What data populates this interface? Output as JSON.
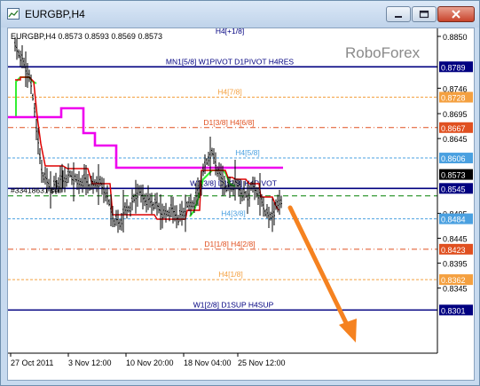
{
  "window": {
    "title": "EURGBP,H4"
  },
  "chart_header": "EURGBP,H4  0.8573 0.8593 0.8569 0.8573",
  "watermark": "RoboForex",
  "price_labels": [
    {
      "text": "0.8850",
      "kind": "scale",
      "color": "#000000"
    },
    {
      "text": "0.8789",
      "kind": "level",
      "color": "#000080"
    },
    {
      "text": "0.8746",
      "kind": "scale",
      "color": "#000000"
    },
    {
      "text": "0.8728",
      "kind": "level",
      "color": "#f4a040"
    },
    {
      "text": "0.8695",
      "kind": "scale",
      "color": "#000000"
    },
    {
      "text": "0.8667",
      "kind": "level",
      "color": "#e05020"
    },
    {
      "text": "0.8645",
      "kind": "scale",
      "color": "#000000"
    },
    {
      "text": "0.8606",
      "kind": "level",
      "color": "#4aa0e0"
    },
    {
      "text": "0.8573",
      "kind": "level",
      "color": "#000000"
    },
    {
      "text": "0.8545",
      "kind": "level",
      "color": "#000080"
    },
    {
      "text": "0.8495",
      "kind": "scale",
      "color": "#000000"
    },
    {
      "text": "0.8484",
      "kind": "level",
      "color": "#4aa0e0"
    },
    {
      "text": "0.8445",
      "kind": "scale",
      "color": "#000000"
    },
    {
      "text": "0.8423",
      "kind": "level",
      "color": "#e05020"
    },
    {
      "text": "0.8395",
      "kind": "scale",
      "color": "#000000"
    },
    {
      "text": "0.8362",
      "kind": "level",
      "color": "#f4a040"
    },
    {
      "text": "0.8345",
      "kind": "scale",
      "color": "#000000"
    },
    {
      "text": "0.8301",
      "kind": "level",
      "color": "#000080"
    }
  ],
  "level_lines": [
    {
      "label": "H4[+1/8]",
      "price": 0.885,
      "color": "#000080",
      "style": "none"
    },
    {
      "label": "MN1[5/8] W1PIVOT D1PIVOT H4RES",
      "price": 0.8789,
      "color": "#000080",
      "style": "solid"
    },
    {
      "label": "H4[7/8]",
      "price": 0.8728,
      "color": "#f4a040",
      "style": "dash"
    },
    {
      "label": "D1[3/8] H4[6/8]",
      "price": 0.8667,
      "color": "#e05020",
      "style": "dashdot"
    },
    {
      "label": "H4[5/8]",
      "price": 0.8606,
      "color": "#4aa0e0",
      "style": "dash"
    },
    {
      "label": "W1[3/8] D1[2/8] H4PIVOT",
      "price": 0.8545,
      "color": "#000080",
      "style": "solid"
    },
    {
      "label": "H4[3/8]",
      "price": 0.8484,
      "color": "#4aa0e0",
      "style": "dash"
    },
    {
      "label": "D1[1/8] H4[2/8]",
      "price": 0.8423,
      "color": "#e05020",
      "style": "dashdot"
    },
    {
      "label": "H4[1/8]",
      "price": 0.8362,
      "color": "#f4a040",
      "style": "dash"
    },
    {
      "label": "W1[2/8] D1SUP H4SUP",
      "price": 0.8301,
      "color": "#000080",
      "style": "solid"
    }
  ],
  "order_label": "#33418631 sell",
  "order_price": 0.853,
  "time_labels": [
    "27 Oct 2011",
    "3 Nov 12:00",
    "10 Nov 20:00",
    "18 Nov 04:00",
    "25 Nov 12:00"
  ],
  "colors": {
    "candles": "#000000",
    "red_indicator": "#dd0000",
    "green_indicator": "#33ee33",
    "magenta_indicator": "#ee00ee",
    "forecast_arrow": "#f58220",
    "order_line": "#008000"
  }
}
